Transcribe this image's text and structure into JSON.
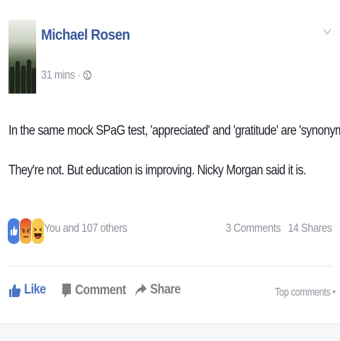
{
  "post": {
    "author": "Michael Rosen",
    "timestamp": "31 mins",
    "separator": "·",
    "privacy_icon": "globe-icon",
    "menu_icon": "chevron-down-icon",
    "text_line_1": "In the same mock SPaG test, 'appreciated' and 'gratitude' are 'synonyms'.",
    "text_line_2": "They're not. But education is improving. Nicky Morgan said it is."
  },
  "reactions": {
    "icons": [
      "like-icon",
      "angry-icon",
      "haha-icon"
    ],
    "summary": "You and 107 others",
    "comments": "3 Comments",
    "shares": "14 Shares"
  },
  "actions": {
    "like": "Like",
    "comment": "Comment",
    "share": "Share",
    "top_comments": "Top comments",
    "caret": "▾"
  },
  "colors": {
    "author": "#365899",
    "like_active": "#4b72c2",
    "muted": "#90949c",
    "action": "#7f7f7f",
    "text": "#1d2129"
  }
}
